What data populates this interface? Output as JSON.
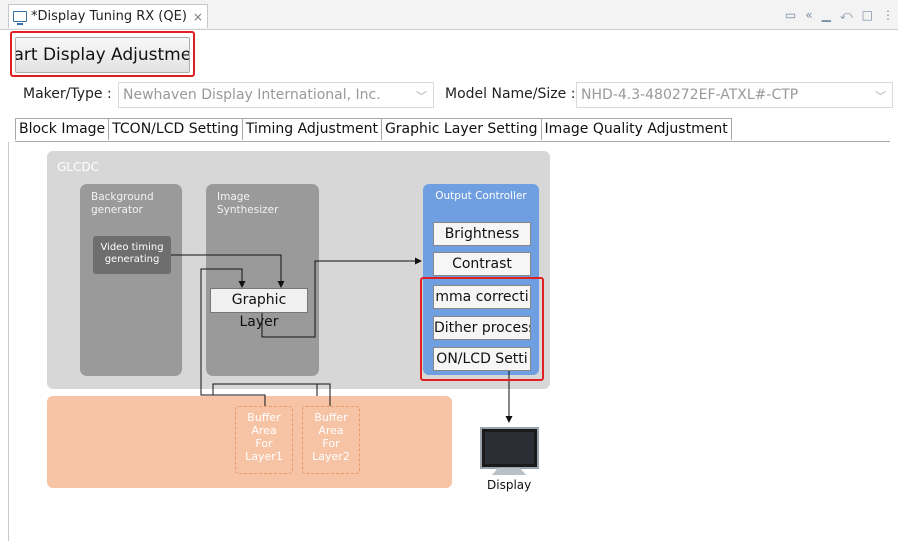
{
  "window": {
    "tab_title": "*Display Tuning RX (QE)",
    "close_glyph": "×",
    "toolbar_icons": [
      "view-menu-icon",
      "back-icon",
      "minimize-icon",
      "restore-icon",
      "maximize-icon",
      "more-icon"
    ]
  },
  "actions": {
    "start_button": "tart Display Adjustmer"
  },
  "settings": {
    "maker_label": "Maker/Type :",
    "maker_value": "Newhaven Display International, Inc.",
    "model_label": "Model Name/Size :",
    "model_value": "NHD-4.3-480272EF-ATXL#-CTP"
  },
  "tabs": [
    "Block Image",
    "TCON/LCD Setting",
    "Timing Adjustment",
    "Graphic Layer Setting",
    "Image Quality Adjustment"
  ],
  "diagram": {
    "glcdc": "GLCDC",
    "background_generator": [
      "Background",
      "generator"
    ],
    "video_timing": [
      "Video timing",
      "generating"
    ],
    "image_synthesizer": [
      "Image",
      "Synthesizer"
    ],
    "graphic_layer": "Graphic Layer",
    "output_controller": "Output Controller",
    "outputs": [
      "Brightness",
      "Contrast",
      "mma correcti",
      "Dither process",
      "ON/LCD Setti"
    ],
    "buffer1": [
      "Buffer",
      "Area",
      "For",
      "Layer1"
    ],
    "buffer2": [
      "Buffer",
      "Area",
      "For",
      "Layer2"
    ],
    "display": "Display"
  },
  "colors": {
    "highlight": "#e02020",
    "output_controller": "#6f9fe0",
    "buffer_area": "#f6c3a4",
    "glcdc_bg": "#d7d7d7"
  }
}
